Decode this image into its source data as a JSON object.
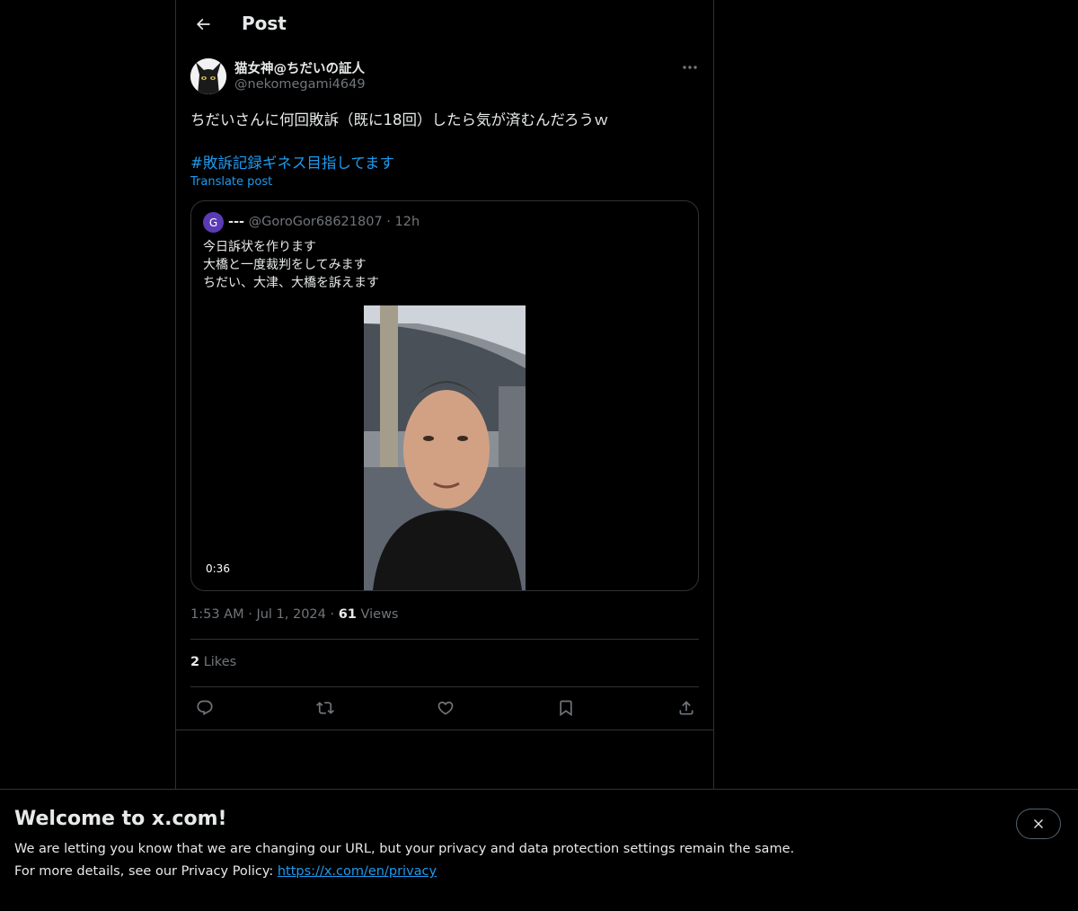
{
  "header": {
    "title": "Post",
    "back_icon": "arrow-left-icon"
  },
  "post": {
    "author_name": "猫女神@ちだいの証人",
    "author_handle": "@nekomegami4649",
    "more_icon": "more-horizontal-icon",
    "text": "ちだいさんに何回敗訴（既に18回）したら気が済むんだろうｗ",
    "hashtag": "#敗訴記録ギネス目指してます",
    "translate_label": "Translate post",
    "time": "1:53 AM",
    "date": "Jul 1, 2024",
    "views_count": "61",
    "views_label": "Views",
    "likes_count": "2",
    "likes_label": "Likes",
    "separator": "·"
  },
  "quote": {
    "avatar_letter": "G",
    "name": "---",
    "handle": "@GoroGor68621807",
    "time": "12h",
    "lines": [
      "今日訴状を作ります",
      "大橋と一度裁判をしてみます",
      "ちだい、大津、大橋を訴えます"
    ],
    "video_duration": "0:36"
  },
  "actions": {
    "reply_icon": "reply-icon",
    "repost_icon": "repost-icon",
    "like_icon": "heart-icon",
    "bookmark_icon": "bookmark-icon",
    "share_icon": "share-icon"
  },
  "banner": {
    "title": "Welcome to x.com!",
    "line1": "We are letting you know that we are changing our URL, but your privacy and data protection settings remain the same.",
    "line2_prefix": "For more details, see our Privacy Policy: ",
    "link": "https://x.com/en/privacy",
    "close_icon": "close-icon"
  },
  "colors": {
    "background": "#000000",
    "text": "#e7e9ea",
    "secondary": "#71767b",
    "link": "#1d9bf0",
    "border": "#2f3336"
  }
}
